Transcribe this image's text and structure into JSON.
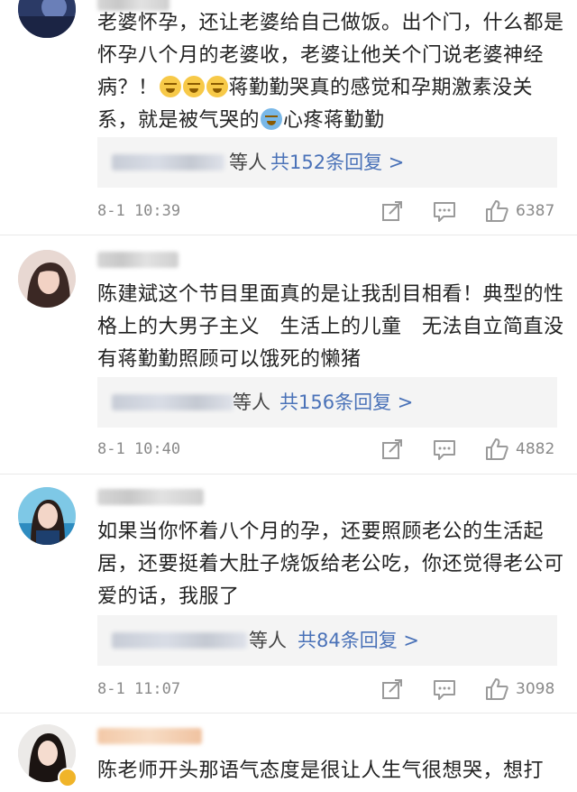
{
  "comments": [
    {
      "text_parts": [
        "老婆怀孕，还让老婆给自己做饭。出个门，什么都是怀孕八个月的老婆收，老婆让他关个门说老婆神经病？！",
        "蒋勤勤哭真的感觉和孕期激素没关系，就是被气哭的",
        "心疼蒋勤勤"
      ],
      "reply_suffix": "等人",
      "reply_link": "共152条回复 >",
      "time": "8-1 10:39",
      "likes": "6387"
    },
    {
      "text": "陈建斌这个节目里面真的是让我刮目相看！典型的性格上的大男子主义　生活上的儿童　无法自立简直没有蒋勤勤照顾可以饿死的懒猪",
      "reply_suffix": "等人",
      "reply_link": "共156条回复 >",
      "time": "8-1 10:40",
      "likes": "4882"
    },
    {
      "text": "如果当你怀着八个月的孕，还要照顾老公的生活起居，还要挺着大肚子烧饭给老公吃，你还觉得老公可爱的话，我服了",
      "reply_suffix": "等人",
      "reply_link": "共84条回复 >",
      "time": "8-1 11:07",
      "likes": "3098"
    },
    {
      "text": "陈老师开头那语气态度是很让人生气很想哭，想打"
    }
  ],
  "icons": {
    "share": "share-icon",
    "comment": "comment-icon",
    "like": "thumbs-up-icon"
  },
  "colors": {
    "link": "#4a72b8",
    "meta": "#8a8a8a",
    "reply_bg": "#f4f4f4"
  }
}
